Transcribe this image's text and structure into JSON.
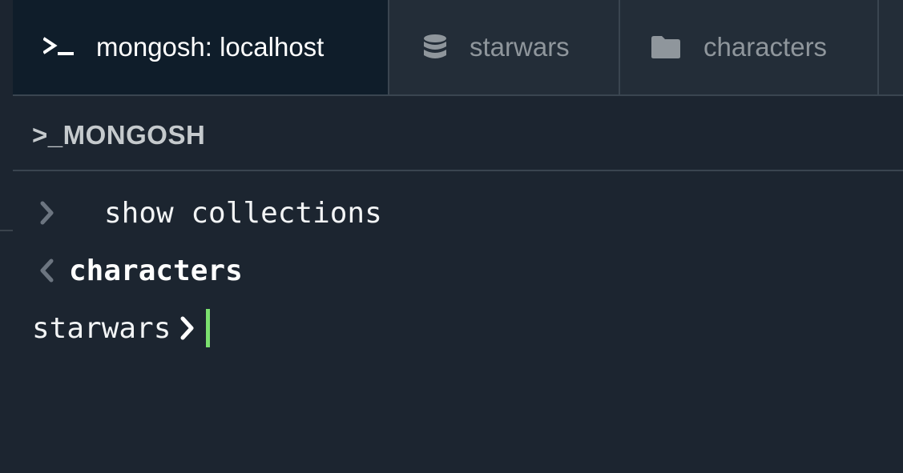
{
  "tabs": [
    {
      "label": "mongosh: localhost",
      "icon": "terminal-icon",
      "active": true
    },
    {
      "label": "starwars",
      "icon": "database-icon",
      "active": false
    },
    {
      "label": "characters",
      "icon": "folder-icon",
      "active": false
    }
  ],
  "shell": {
    "title": ">_MONGOSH"
  },
  "output": {
    "command": "show collections",
    "result": "characters",
    "prompt_db": "starwars"
  },
  "colors": {
    "background": "#1c2530",
    "tabbar": "#232d38",
    "active_tab": "#0f1d2a",
    "cursor": "#7be06f"
  }
}
